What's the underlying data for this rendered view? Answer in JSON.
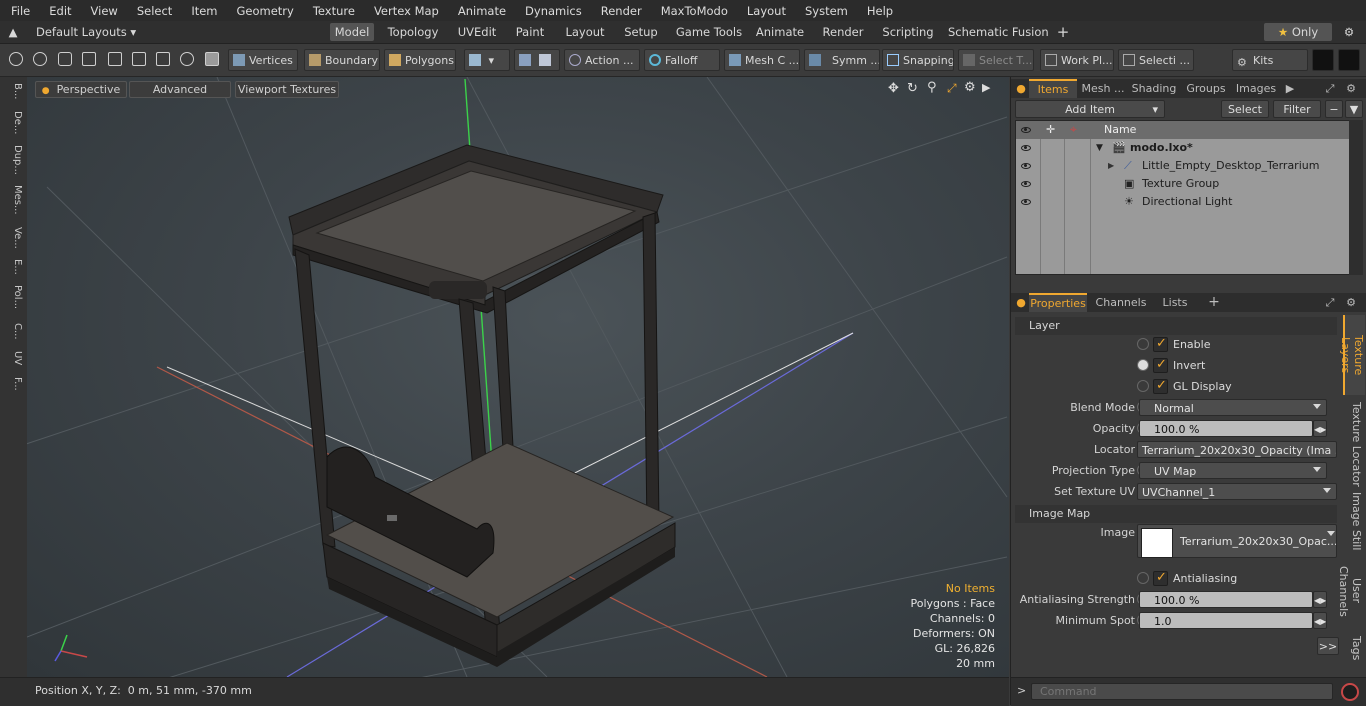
{
  "menu": [
    "File",
    "Edit",
    "View",
    "Select",
    "Item",
    "Geometry",
    "Texture",
    "Vertex Map",
    "Animate",
    "Dynamics",
    "Render",
    "MaxToModo",
    "Layout",
    "System",
    "Help"
  ],
  "layout_bar": {
    "layout_select": "Default Layouts",
    "tabs": [
      "Model",
      "Topology",
      "UVEdit",
      "Paint",
      "Layout",
      "Setup",
      "Game Tools",
      "Animate",
      "Render",
      "Scripting",
      "Schematic Fusion"
    ],
    "only_label": "Only"
  },
  "toolbar": {
    "vertices": "Vertices",
    "boundary": "Boundary",
    "polygons": "Polygons",
    "action": "Action",
    "falloff": "Falloff",
    "mesh": "Mesh C ...",
    "symm": "Symm ...",
    "snapping": "Snapping",
    "select_t": "Select T...",
    "work_pl": "Work Pl...",
    "selecti": "Selecti ...",
    "kits": "Kits"
  },
  "left_tabs": [
    "B...",
    "De...",
    "Dup...",
    "Mes...",
    "Ve...",
    "E...",
    "Pol...",
    "C...",
    "UV",
    "F..."
  ],
  "viewport": {
    "perspective": "Perspective",
    "advanced": "Advanced",
    "viewport_textures": "Viewport Textures",
    "info": {
      "no_items": "No Items",
      "polygons": "Polygons : Face",
      "channels": "Channels: 0",
      "deformers": "Deformers: ON",
      "gl": "GL: 26,826",
      "scale": "20 mm"
    }
  },
  "status": {
    "position": "Position X, Y, Z:  0 m, 51 mm, -370 mm"
  },
  "items_panel": {
    "tabs": [
      "Items",
      "Mesh ...",
      "Shading",
      "Groups",
      "Images"
    ],
    "add_item": "Add Item",
    "select": "Select",
    "filter": "Filter",
    "name_header": "Name",
    "rows": [
      {
        "label": "modo.lxo*"
      },
      {
        "label": "Little_Empty_Desktop_Terrarium"
      },
      {
        "label": "Texture Group"
      },
      {
        "label": "Directional Light"
      }
    ]
  },
  "properties_panel": {
    "tabs": [
      "Properties",
      "Channels",
      "Lists"
    ],
    "side_tabs": [
      "Texture Layers",
      "Texture Locator",
      "Image Still",
      "User Channels",
      "Tags"
    ],
    "layer_header": "Layer",
    "enable": "Enable",
    "invert": "Invert",
    "gl_display": "GL Display",
    "blend_mode_label": "Blend Mode",
    "blend_mode": "Normal",
    "opacity_label": "Opacity",
    "opacity": "100.0 %",
    "locator_label": "Locator",
    "locator": "Terrarium_20x20x30_Opacity (Ima ...",
    "projection_label": "Projection Type",
    "projection": "UV Map",
    "uv_label": "Set Texture UV",
    "uv": "UVChannel_1",
    "image_map_header": "Image Map",
    "image_label": "Image",
    "image": "Terrarium_20x20x30_Opac...",
    "antialiasing": "Antialiasing",
    "aa_strength_label": "Antialiasing Strength",
    "aa_strength": "100.0 %",
    "min_spot_label": "Minimum Spot",
    "min_spot": "1.0",
    "more": ">>"
  },
  "command": {
    "placeholder": "Command"
  }
}
